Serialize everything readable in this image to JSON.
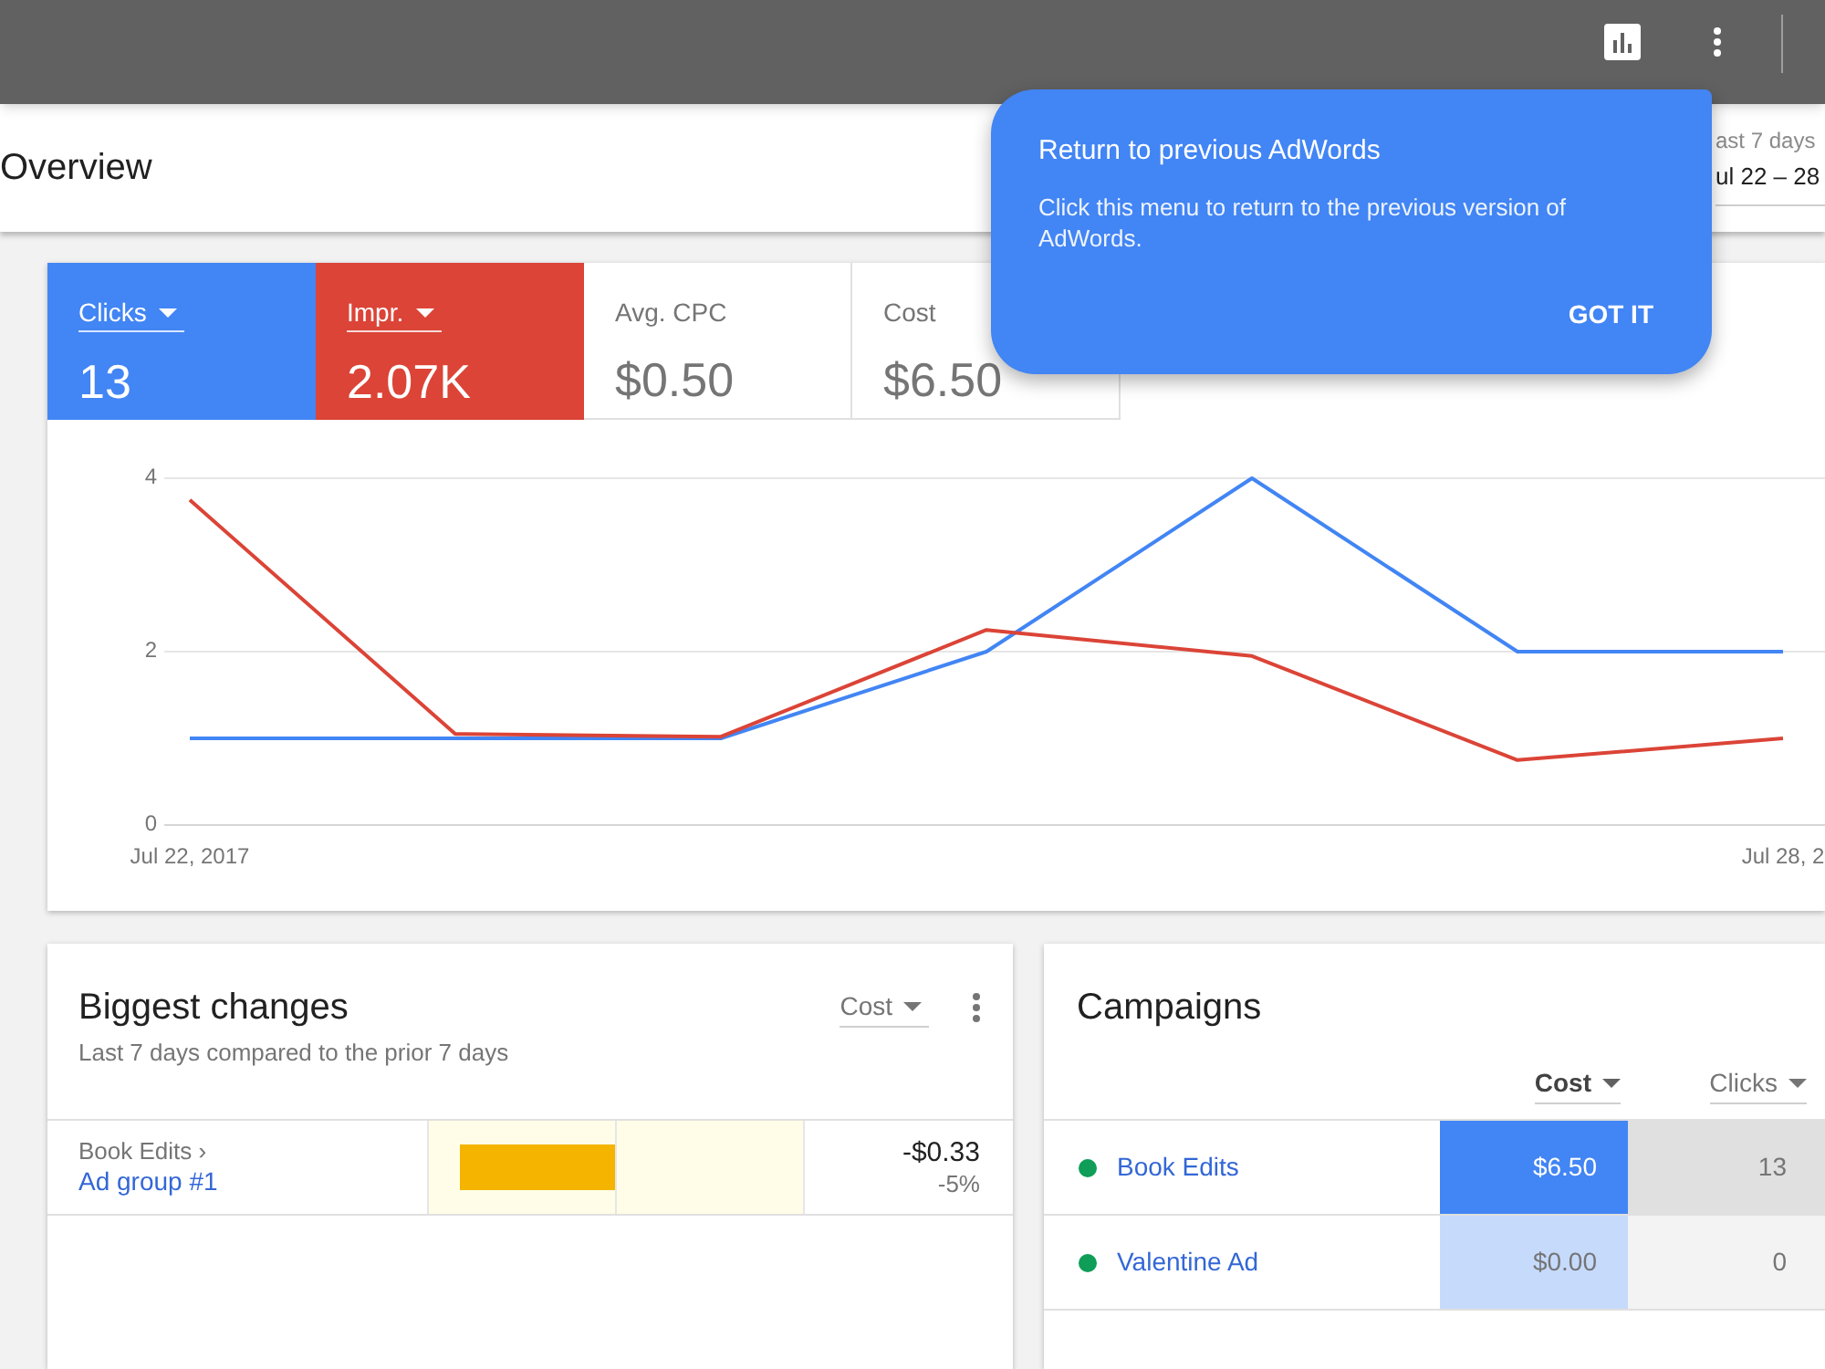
{
  "header": {
    "title": "Overview",
    "date_range": {
      "label": "ast 7 days",
      "value": "ul 22 – 28"
    }
  },
  "popup": {
    "title": "Return to previous AdWords",
    "text": "Click this menu to return to the previous version of AdWords.",
    "button": "GOT IT"
  },
  "performance": {
    "metrics": [
      {
        "label": "Clicks",
        "value": "13",
        "selected": true,
        "color": "#4285f4"
      },
      {
        "label": "Impr.",
        "value": "2.07K",
        "selected": true,
        "color": "#db4437"
      },
      {
        "label": "Avg. CPC",
        "value": "$0.50",
        "selected": false
      },
      {
        "label": "Cost",
        "value": "$6.50",
        "selected": false
      }
    ],
    "chart_data": [
      {
        "type": "line",
        "categories": [
          "Jul 22, 2017",
          null,
          null,
          null,
          null,
          null,
          "Jul 28, 2"
        ],
        "ylim": [
          0,
          4
        ],
        "yticks": [
          0,
          2,
          4
        ],
        "grid": true,
        "series": [
          {
            "color": "#4285f4",
            "values": [
              1,
              1,
              1,
              2,
              4,
              2,
              2
            ]
          },
          {
            "color": "#db4437",
            "values": [
              3.75,
              1.05,
              1.02,
              2.25,
              1.95,
              0.75,
              1.0
            ]
          }
        ]
      }
    ]
  },
  "biggest_changes": {
    "title": "Biggest changes",
    "subtitle": "Last 7 days compared to the prior 7 days",
    "dropdown": "Cost",
    "rows": [
      {
        "campaign": "Book Edits ›",
        "ad_group": "Ad group #1",
        "level": 0.83,
        "change": "-$0.33",
        "percent": "-5%"
      }
    ]
  },
  "campaigns": {
    "title": "Campaigns",
    "columns": [
      {
        "label": "Cost",
        "selected": true
      },
      {
        "label": "Clicks",
        "selected": false
      }
    ],
    "rows": [
      {
        "name": "Book Edits",
        "color": "#0f9d58",
        "cells": [
          {
            "text": "$6.50",
            "color": "#4285f4"
          },
          {
            "text": "13",
            "color": "#e0e0e0"
          }
        ]
      },
      {
        "name": "Valentine Ad",
        "color": "#0f9d58",
        "cells": [
          {
            "text": "$0.00",
            "color": "#c6dafc"
          },
          {
            "text": "0",
            "color": "#f3f3f3"
          }
        ]
      }
    ]
  }
}
